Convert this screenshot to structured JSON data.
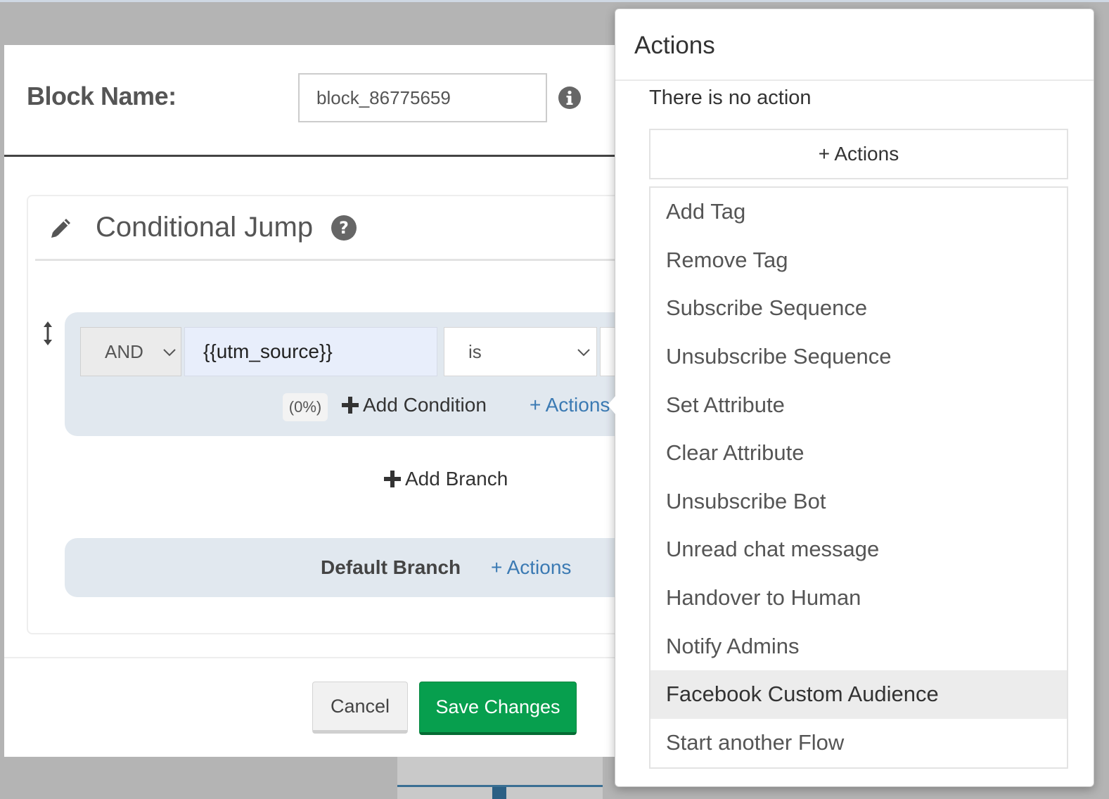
{
  "modal": {
    "block_name_label": "Block Name:",
    "block_name_value": "block_86775659",
    "panel_title": "Conditional Jump",
    "branch": {
      "logic_operator": "AND",
      "attribute": "{{utm_source}}",
      "comparator": "is",
      "percent": "(0%)",
      "add_condition_label": "Add Condition",
      "actions_link": "+ Actions"
    },
    "add_branch_label": "Add Branch",
    "default_branch": {
      "label": "Default Branch",
      "actions_link": "+ Actions"
    },
    "footer": {
      "cancel_label": "Cancel",
      "save_label": "Save Changes"
    }
  },
  "actions_popover": {
    "title": "Actions",
    "empty_text": "There is no action",
    "add_button_label": "+ Actions",
    "items": [
      "Add Tag",
      "Remove Tag",
      "Subscribe Sequence",
      "Unsubscribe Sequence",
      "Set Attribute",
      "Clear Attribute",
      "Unsubscribe Bot",
      "Unread chat message",
      "Handover to Human",
      "Notify Admins",
      "Facebook Custom Audience",
      "Start another Flow"
    ],
    "highlighted_item": "Facebook Custom Audience"
  },
  "colors": {
    "primary_green": "#079f4e",
    "link_blue": "#3b7ab3",
    "branch_bg": "#e1e8ef"
  },
  "icons": {
    "info": "info-icon",
    "edit": "pencil-icon",
    "help": "question-circle-icon",
    "reorder": "vertical-move-icon",
    "plus": "plus-icon",
    "dropdown": "chevron-down-icon"
  }
}
